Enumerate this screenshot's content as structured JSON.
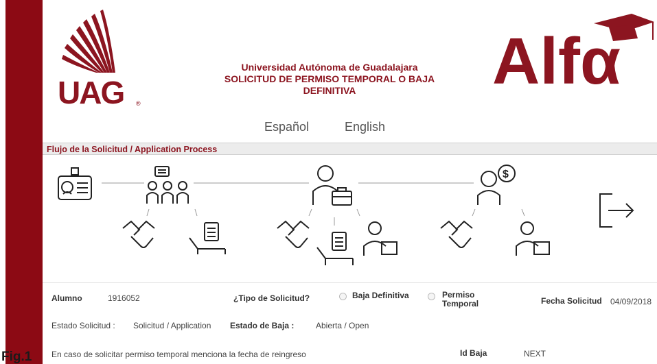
{
  "header": {
    "university": "Universidad Autónoma de Guadalajara",
    "form_title_line1": "SOLICITUD DE PERMISO TEMPORAL O BAJA",
    "form_title_line2": "DEFINITIVA",
    "uag_logo_text": "UAG",
    "alfa_logo_text": "Alfα"
  },
  "languages": {
    "spanish": "Español",
    "english": "English"
  },
  "process": {
    "title": "Flujo de la Solicitud / Application Process"
  },
  "form": {
    "alumno_label": "Alumno",
    "alumno_value": "1916052",
    "tipo_label": "¿Tipo de Solicitud?",
    "option_baja": "Baja Definitiva",
    "option_permiso_line1": "Permiso",
    "option_permiso_line2": "Temporal",
    "fecha_label": "Fecha Solicitud",
    "fecha_value": "04/09/2018",
    "estado_solicitud_label": "Estado Solicitud :",
    "estado_solicitud_value": "Solicitud / Application",
    "estado_baja_label": "Estado de Baja :",
    "estado_baja_value": "Abierta / Open",
    "reingreso_text": "En caso de solicitar permiso temporal menciona la fecha de reingreso",
    "id_baja_label": "Id Baja",
    "id_baja_value": "NEXT"
  },
  "figure_label": "Fig.1",
  "colors": {
    "brand": "#8c1520",
    "sidebar": "#8c0a14"
  }
}
